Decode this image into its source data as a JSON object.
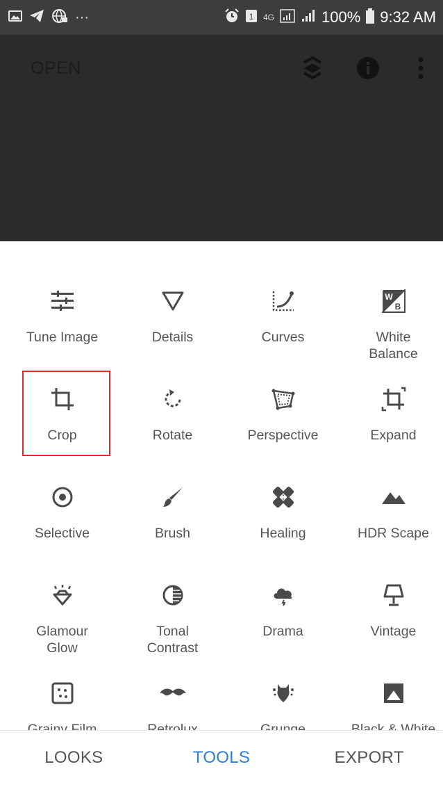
{
  "status_bar": {
    "network": "4G",
    "battery": "100%",
    "time": "9:32 AM"
  },
  "header": {
    "open_label": "OPEN"
  },
  "tools": [
    {
      "label": "Tune Image",
      "icon": "tune-image-icon"
    },
    {
      "label": "Details",
      "icon": "details-icon"
    },
    {
      "label": "Curves",
      "icon": "curves-icon"
    },
    {
      "label": "White Balance",
      "icon": "white-balance-icon"
    },
    {
      "label": "Crop",
      "icon": "crop-icon"
    },
    {
      "label": "Rotate",
      "icon": "rotate-icon"
    },
    {
      "label": "Perspective",
      "icon": "perspective-icon"
    },
    {
      "label": "Expand",
      "icon": "expand-icon"
    },
    {
      "label": "Selective",
      "icon": "selective-icon"
    },
    {
      "label": "Brush",
      "icon": "brush-icon"
    },
    {
      "label": "Healing",
      "icon": "healing-icon"
    },
    {
      "label": "HDR Scape",
      "icon": "hdr-scape-icon"
    },
    {
      "label": "Glamour Glow",
      "icon": "glamour-glow-icon"
    },
    {
      "label": "Tonal Contrast",
      "icon": "tonal-contrast-icon"
    },
    {
      "label": "Drama",
      "icon": "drama-icon"
    },
    {
      "label": "Vintage",
      "icon": "vintage-icon"
    },
    {
      "label": "Grainy Film",
      "icon": "grainy-film-icon"
    },
    {
      "label": "Retrolux",
      "icon": "retrolux-icon"
    },
    {
      "label": "Grunge",
      "icon": "grunge-icon"
    },
    {
      "label": "Black & White",
      "icon": "black-white-icon"
    }
  ],
  "bottom_nav": {
    "looks": "LOOKS",
    "tools": "TOOLS",
    "export": "EXPORT",
    "active_color": "#2f7fd8"
  },
  "colors": {
    "status_bar": "#3d3d3d",
    "dim_overlay": "#2b2b2b",
    "highlight": "#e8262c",
    "icon_gray": "#444444"
  }
}
